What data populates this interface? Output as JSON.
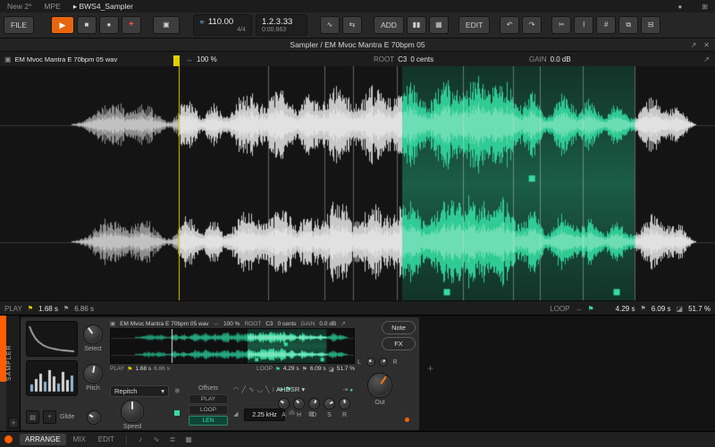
{
  "tabs": {
    "items": [
      "New 2*",
      "MPE",
      "BWS4_Sampler"
    ]
  },
  "transport": {
    "file": "FILE",
    "add": "ADD",
    "edit": "EDIT",
    "tempo": "110.00",
    "time_sig": "4/4",
    "pos_bars": "1.2.3.33",
    "pos_time": "0:00.863"
  },
  "sampler_header": {
    "title": "Sampler / EM Mvoc Mantra E 70bpm 05"
  },
  "editor": {
    "file_name": "EM Mvoc Mantra E 70bpm 05 wav",
    "zoom": "100 %",
    "root_label": "ROOT",
    "root_note": "C3",
    "root_cents": "0 cents",
    "gain_label": "GAIN",
    "gain_value": "0.0 dB",
    "play_label": "PLAY",
    "play_start": "1.68 s",
    "play_end": "6.86 s",
    "loop_label": "LOOP",
    "loop_start": "4.29 s",
    "loop_end": "6.09 s",
    "loop_fade": "51.7 %"
  },
  "device": {
    "rail_label": "SAMPLER",
    "select_label": "Select",
    "pitch_label": "Pitch",
    "glide_label": "Glide",
    "repitch": "Repitch",
    "speed_label": "Speed",
    "offsets_label": "Offsets",
    "offset_play": "PLAY",
    "offset_loop": "LOOP",
    "offset_len": "LEN",
    "freq_display": "2.25 kHz",
    "ahdsr_label": "AHDSR",
    "env": [
      "A",
      "H",
      "D",
      "S",
      "R"
    ],
    "out_label": "Out",
    "note_btn": "Note",
    "fx_btn": "FX",
    "meter_l": "L",
    "meter_r": "R"
  },
  "status_bar": {
    "arrange": "ARRANGE",
    "mix": "MIX",
    "edit": "EDIT"
  },
  "icons": {
    "play": "▶",
    "stop": "■",
    "record": "●",
    "overdub": "+",
    "display": "▣",
    "groove": "≋",
    "automation": "∿",
    "loop": "⇆",
    "chart": "▮▮",
    "grid": "▦",
    "undo": "↶",
    "redo": "↷",
    "scissors": "✂",
    "ibeam": "I",
    "snap": "#",
    "layers": "⧉",
    "panel": "⊟",
    "dot": "●",
    "window": "⊞",
    "tri_right": "▸",
    "tri_down": "▾",
    "expand": "↗",
    "close": "✕",
    "zoom_h": "↔",
    "flag": "⚑",
    "arrow": "→",
    "fade": "◪",
    "snowflake": "❄",
    "folder": "▤",
    "plus": "+",
    "note": "♪",
    "lanes": "≣",
    "meter": "ıllı",
    "tri": "◢",
    "skip": "⇥",
    "shapes": [
      "◠",
      "╱",
      "∿",
      "◡",
      "╲",
      "≀"
    ]
  },
  "waveform": {
    "play_start_frac": 0.25,
    "loop_start_frac": 0.5625,
    "loop_end_frac": 0.8875,
    "slice_lines": [
      0.375,
      0.454,
      0.494,
      0.555,
      0.648,
      0.718,
      0.755,
      0.815
    ],
    "color_loop": "#35DDA2",
    "color_play_line": "#D9CB00"
  },
  "colors": {
    "accent_orange": "#FF5E00",
    "teal": "#35DDA2",
    "yellow": "#E0D000"
  }
}
